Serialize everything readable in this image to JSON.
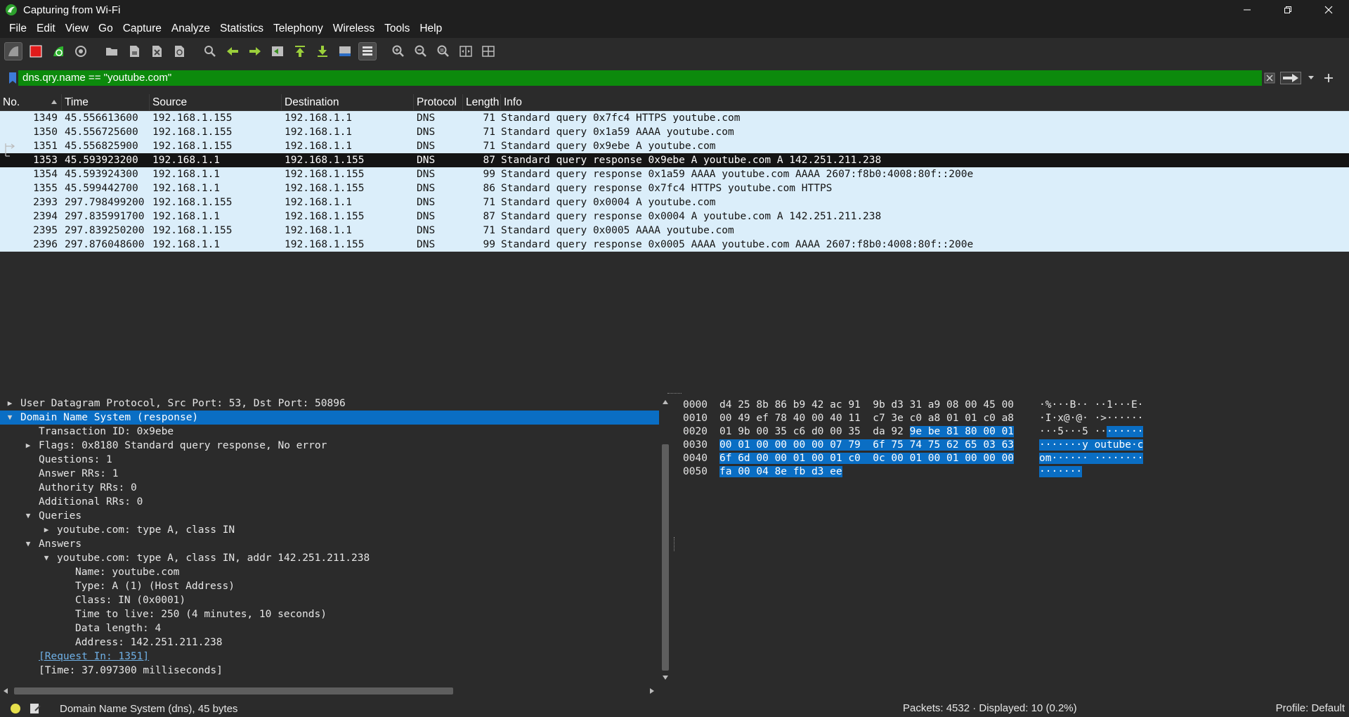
{
  "window": {
    "title": "Capturing from Wi-Fi",
    "controls": [
      "minimize",
      "restore",
      "close"
    ]
  },
  "menu": [
    "File",
    "Edit",
    "View",
    "Go",
    "Capture",
    "Analyze",
    "Statistics",
    "Telephony",
    "Wireless",
    "Tools",
    "Help"
  ],
  "toolbar_icons": [
    "start-capture-icon",
    "stop-capture-icon",
    "restart-capture-icon",
    "capture-options-icon",
    "open-file-icon",
    "save-file-icon",
    "close-file-icon",
    "reload-file-icon",
    "find-packet-icon",
    "go-back-icon",
    "go-forward-icon",
    "go-to-packet-icon",
    "go-first-icon",
    "go-last-icon",
    "auto-scroll-icon",
    "colorize-icon",
    "zoom-in-icon",
    "zoom-out-icon",
    "normal-size-icon",
    "resize-columns-icon",
    "layout-icon"
  ],
  "filter": {
    "value": "dns.qry.name == \"youtube.com\"",
    "color": "#0c8a0c"
  },
  "packet_list": {
    "columns": [
      "No.",
      "Time",
      "Source",
      "Destination",
      "Protocol",
      "Length",
      "Info"
    ],
    "sort_column": "No.",
    "rows": [
      {
        "no": "1349",
        "time": "45.556613600",
        "src": "192.168.1.155",
        "dst": "192.168.1.1",
        "proto": "DNS",
        "len": "71",
        "info": "Standard query 0x7fc4 HTTPS youtube.com"
      },
      {
        "no": "1350",
        "time": "45.556725600",
        "src": "192.168.1.155",
        "dst": "192.168.1.1",
        "proto": "DNS",
        "len": "71",
        "info": "Standard query 0x1a59 AAAA youtube.com"
      },
      {
        "no": "1351",
        "time": "45.556825900",
        "src": "192.168.1.155",
        "dst": "192.168.1.1",
        "proto": "DNS",
        "len": "71",
        "info": "Standard query 0x9ebe A youtube.com"
      },
      {
        "no": "1353",
        "time": "45.593923200",
        "src": "192.168.1.1",
        "dst": "192.168.1.155",
        "proto": "DNS",
        "len": "87",
        "info": "Standard query response 0x9ebe A youtube.com A 142.251.211.238",
        "selected": true
      },
      {
        "no": "1354",
        "time": "45.593924300",
        "src": "192.168.1.1",
        "dst": "192.168.1.155",
        "proto": "DNS",
        "len": "99",
        "info": "Standard query response 0x1a59 AAAA youtube.com AAAA 2607:f8b0:4008:80f::200e"
      },
      {
        "no": "1355",
        "time": "45.599442700",
        "src": "192.168.1.1",
        "dst": "192.168.1.155",
        "proto": "DNS",
        "len": "86",
        "info": "Standard query response 0x7fc4 HTTPS youtube.com HTTPS"
      },
      {
        "no": "2393",
        "time": "297.798499200",
        "src": "192.168.1.155",
        "dst": "192.168.1.1",
        "proto": "DNS",
        "len": "71",
        "info": "Standard query 0x0004 A youtube.com"
      },
      {
        "no": "2394",
        "time": "297.835991700",
        "src": "192.168.1.1",
        "dst": "192.168.1.155",
        "proto": "DNS",
        "len": "87",
        "info": "Standard query response 0x0004 A youtube.com A 142.251.211.238"
      },
      {
        "no": "2395",
        "time": "297.839250200",
        "src": "192.168.1.155",
        "dst": "192.168.1.1",
        "proto": "DNS",
        "len": "71",
        "info": "Standard query 0x0005 AAAA youtube.com"
      },
      {
        "no": "2396",
        "time": "297.876048600",
        "src": "192.168.1.1",
        "dst": "192.168.1.155",
        "proto": "DNS",
        "len": "99",
        "info": "Standard query response 0x0005 AAAA youtube.com AAAA 2607:f8b0:4008:80f::200e"
      }
    ]
  },
  "details": [
    {
      "text": "User Datagram Protocol, Src Port: 53, Dst Port: 50896",
      "level": 0,
      "arrow": "collapsed"
    },
    {
      "text": "Domain Name System (response)",
      "level": 0,
      "arrow": "expanded",
      "selected": true
    },
    {
      "text": "Transaction ID: 0x9ebe",
      "level": 1,
      "arrow": "none"
    },
    {
      "text": "Flags: 0x8180 Standard query response, No error",
      "level": 1,
      "arrow": "collapsed"
    },
    {
      "text": "Questions: 1",
      "level": 1,
      "arrow": "none"
    },
    {
      "text": "Answer RRs: 1",
      "level": 1,
      "arrow": "none"
    },
    {
      "text": "Authority RRs: 0",
      "level": 1,
      "arrow": "none"
    },
    {
      "text": "Additional RRs: 0",
      "level": 1,
      "arrow": "none"
    },
    {
      "text": "Queries",
      "level": 1,
      "arrow": "expanded"
    },
    {
      "text": "youtube.com: type A, class IN",
      "level": 2,
      "arrow": "collapsed"
    },
    {
      "text": "Answers",
      "level": 1,
      "arrow": "expanded"
    },
    {
      "text": "youtube.com: type A, class IN, addr 142.251.211.238",
      "level": 2,
      "arrow": "expanded"
    },
    {
      "text": "Name: youtube.com",
      "level": 3,
      "arrow": "none"
    },
    {
      "text": "Type: A (1) (Host Address)",
      "level": 3,
      "arrow": "none"
    },
    {
      "text": "Class: IN (0x0001)",
      "level": 3,
      "arrow": "none"
    },
    {
      "text": "Time to live: 250 (4 minutes, 10 seconds)",
      "level": 3,
      "arrow": "none"
    },
    {
      "text": "Data length: 4",
      "level": 3,
      "arrow": "none"
    },
    {
      "text": "Address: 142.251.211.238",
      "level": 3,
      "arrow": "none"
    },
    {
      "text": "[Request In: 1351]",
      "level": 1,
      "arrow": "none",
      "link": true
    },
    {
      "text": "[Time: 37.097300 milliseconds]",
      "level": 1,
      "arrow": "none"
    }
  ],
  "bytes": {
    "offsets": [
      "0000",
      "0010",
      "0020",
      "0030",
      "0040",
      "0050"
    ],
    "lines": [
      {
        "hex_plain": "d4 25 8b 86 b9 42 ac 91  9b d3 31 a9 08 00 45 00",
        "hex_hl": "",
        "ascii_plain": "·%···B·· ··1···E·",
        "ascii_hl": ""
      },
      {
        "hex_plain": "00 49 ef 78 40 00 40 11  c7 3e c0 a8 01 01 c0 a8",
        "hex_hl": "",
        "ascii_plain": "·I·x@·@· ·>······",
        "ascii_hl": ""
      },
      {
        "hex_plain": "01 9b 00 35 c6 d0 00 35  da 92 ",
        "hex_hl": "9e be 81 80 00 01",
        "ascii_plain": "···5···5 ··",
        "ascii_hl": "······"
      },
      {
        "hex_plain": "",
        "hex_hl": "00 01 00 00 00 00 07 79  6f 75 74 75 62 65 03 63",
        "ascii_plain": "",
        "ascii_hl": "·······y outube·c"
      },
      {
        "hex_plain": "",
        "hex_hl": "6f 6d 00 00 01 00 01 c0  0c 00 01 00 01 00 00 00",
        "ascii_plain": "",
        "ascii_hl": "om······ ········"
      },
      {
        "hex_plain": "",
        "hex_hl": "fa 00 04 8e fb d3 ee",
        "ascii_plain": "",
        "ascii_hl": "·······"
      }
    ]
  },
  "status": {
    "text": "Domain Name System (dns), 45 bytes",
    "packets": "Packets: 4532 · Displayed: 10 (0.2%)",
    "profile": "Profile: Default"
  }
}
